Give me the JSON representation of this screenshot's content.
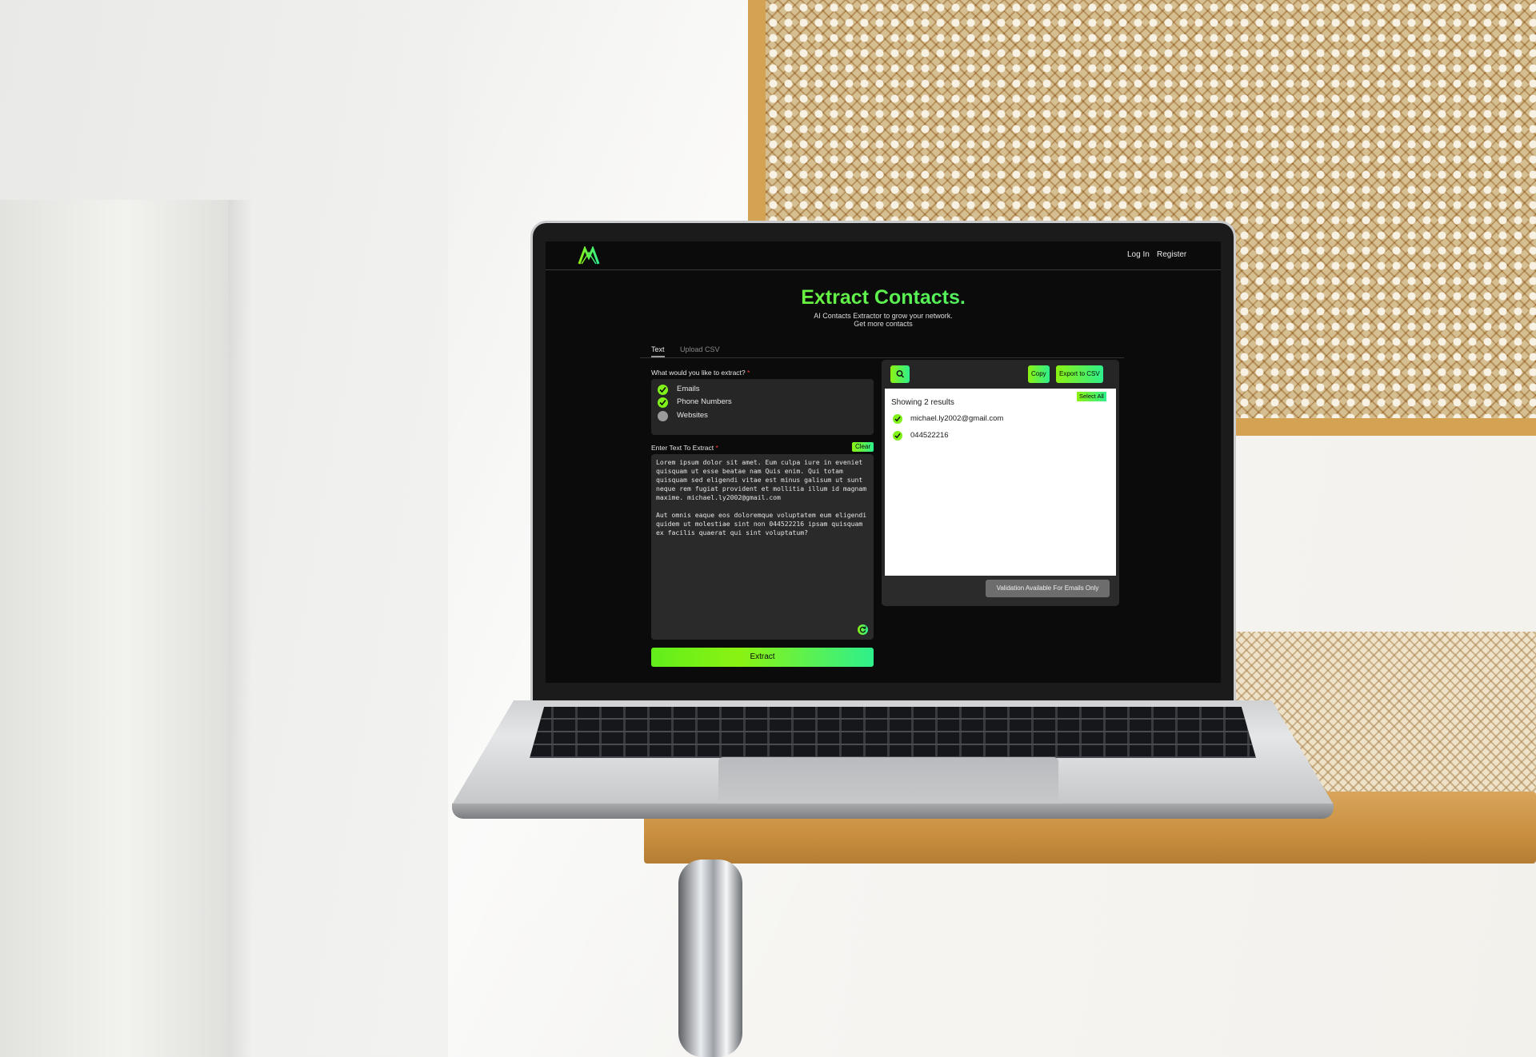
{
  "nav": {
    "login_label": "Log In",
    "register_label": "Register"
  },
  "hero": {
    "title": "Extract Contacts.",
    "subtitle_line1": "AI Contacts Extractor to grow your network.",
    "subtitle_line2": "Get more contacts"
  },
  "tabs": [
    {
      "label": "Text",
      "active": true
    },
    {
      "label": "Upload CSV",
      "active": false
    }
  ],
  "extract_options": {
    "label": "What would you like to extract?",
    "required_mark": "*",
    "items": [
      {
        "label": "Emails",
        "checked": true
      },
      {
        "label": "Phone Numbers",
        "checked": true
      },
      {
        "label": "Websites",
        "checked": false
      }
    ]
  },
  "text_input": {
    "label": "Enter Text To Extract",
    "required_mark": "*",
    "clear_label": "Clear",
    "value": "Lorem ipsum dolor sit amet. Eum culpa iure in eveniet\nquisquam ut esse beatae nam Quis enim. Qui totam\nquisquam sed eligendi vitae est minus galisum ut sunt\nneque rem fugiat provident et mollitia illum id magnam\nmaxime. michael.ly2002@gmail.com\n\nAut omnis eaque eos doloremque voluptatem eum eligendi\nquidem ut molestiae sint non 044522216 ipsam quisquam\nex facilis quaerat qui sint voluptatum?"
  },
  "extract_button_label": "Extract",
  "results": {
    "copy_label": "Copy",
    "export_label": "Export to CSV",
    "showing_text": "Showing 2 results",
    "select_all_label": "Select All",
    "items": [
      {
        "value": "michael.ly2002@gmail.com",
        "checked": true
      },
      {
        "value": "044522216",
        "checked": true
      }
    ],
    "validation_label": "Validation Available For Emails Only"
  },
  "colors": {
    "accent_start": "#8bf212",
    "accent_end": "#2ef08c",
    "background": "#0b0b0b",
    "panel": "#262626"
  },
  "icons": [
    "app-logo-icon",
    "check-icon",
    "search-icon",
    "refresh-icon"
  ]
}
